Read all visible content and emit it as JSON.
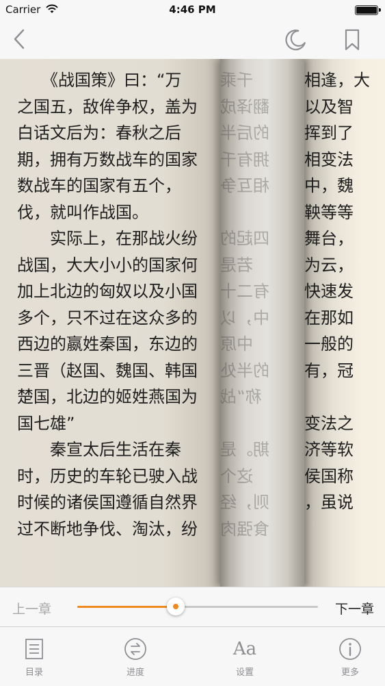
{
  "status_bar": {
    "carrier": "Carrier",
    "time": "4:46 PM"
  },
  "nav_bar": {
    "back_icon": "chevron-left-icon",
    "night_icon": "moon-icon",
    "bookmark_icon": "bookmark-icon"
  },
  "reader": {
    "left_lines": [
      "　　《战国策》曰：“万",
      "之国五，敌侔争权，盖为",
      "白话文后为：春秋之后",
      "期，拥有万数战车的国家",
      "数战车的国家有五个，",
      "伐，就叫作战国。",
      "　　实际上，在那战火纷",
      "战国，大大小小的国家何",
      "加上北边的匈奴以及小国",
      "多个，只不过在这众多的",
      "西边的嬴姓秦国，东边的",
      "三晋（赵国、魏国、韩国",
      "楚国，北边的姬姓燕国为",
      "国七雄”",
      "　　秦宣太后生活在秦",
      "时，历史的车轮已驶入战",
      "时候的诸侯国遵循自然界",
      "过不断地争伐、淘汰，纷"
    ],
    "fold_lines": [
      "千乘",
      "翻译成",
      "的后半",
      "拥有千",
      "相互争",
      "",
      "四起的",
      "若是",
      "有二十",
      "中，以",
      "中原",
      "的半处",
      "称“战",
      "",
      "期。是",
      "这个",
      "则，经",
      "食强肉"
    ],
    "right_lines": [
      "相逢，大",
      "以及智",
      "挥到了",
      "相变法",
      "中，魏",
      "鞅等等",
      "舞台，",
      "为云，",
      "快速发",
      "在那如",
      "一般的",
      "有，冠",
      "",
      "变法之",
      "济等软",
      "侯国称",
      "，虽说",
      ""
    ]
  },
  "progress": {
    "prev_label": "上一章",
    "next_label": "下一章",
    "value": 0.41,
    "accent_color": "#f08a1e"
  },
  "tab_bar": {
    "items": [
      {
        "label": "目录",
        "icon": "list-icon"
      },
      {
        "label": "进度",
        "icon": "progress-icon"
      },
      {
        "label": "设置",
        "icon": "font-settings-icon",
        "glyph": "Aa"
      },
      {
        "label": "更多",
        "icon": "info-icon"
      }
    ]
  }
}
